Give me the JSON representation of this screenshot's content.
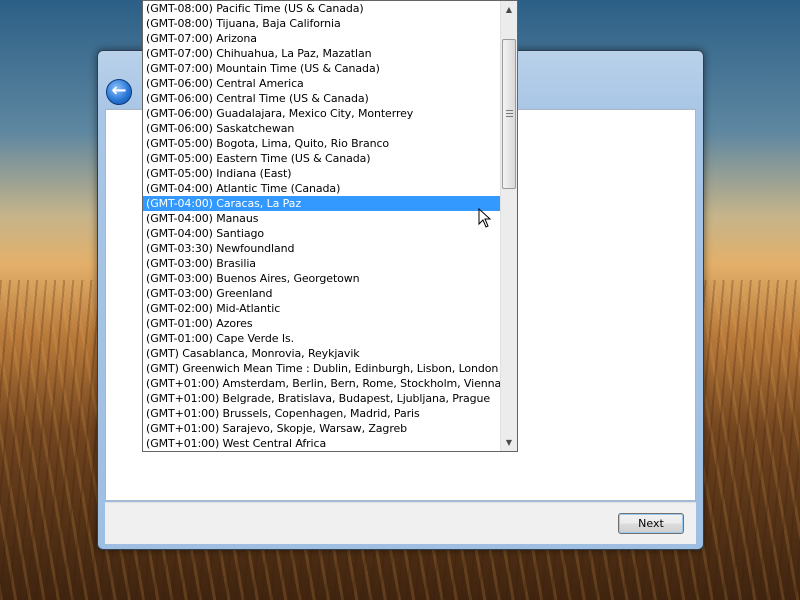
{
  "dialog": {
    "next_label": "Next"
  },
  "icons": {
    "back": "back-arrow-icon",
    "scroll_up": "scroll-up-arrow-icon",
    "scroll_down": "scroll-down-arrow-icon",
    "cursor": "mouse-pointer-icon"
  },
  "colors": {
    "selection": "#3399ff",
    "window_frame": "#a9c6e6"
  },
  "timezones": {
    "selected_index": 13,
    "items": [
      "(GMT-08:00) Pacific Time (US & Canada)",
      "(GMT-08:00) Tijuana, Baja California",
      "(GMT-07:00) Arizona",
      "(GMT-07:00) Chihuahua, La Paz, Mazatlan",
      "(GMT-07:00) Mountain Time (US & Canada)",
      "(GMT-06:00) Central America",
      "(GMT-06:00) Central Time (US & Canada)",
      "(GMT-06:00) Guadalajara, Mexico City, Monterrey",
      "(GMT-06:00) Saskatchewan",
      "(GMT-05:00) Bogota, Lima, Quito, Rio Branco",
      "(GMT-05:00) Eastern Time (US & Canada)",
      "(GMT-05:00) Indiana (East)",
      "(GMT-04:00) Atlantic Time (Canada)",
      "(GMT-04:00) Caracas, La Paz",
      "(GMT-04:00) Manaus",
      "(GMT-04:00) Santiago",
      "(GMT-03:30) Newfoundland",
      "(GMT-03:00) Brasilia",
      "(GMT-03:00) Buenos Aires, Georgetown",
      "(GMT-03:00) Greenland",
      "(GMT-02:00) Mid-Atlantic",
      "(GMT-01:00) Azores",
      "(GMT-01:00) Cape Verde Is.",
      "(GMT) Casablanca, Monrovia, Reykjavik",
      "(GMT) Greenwich Mean Time : Dublin, Edinburgh, Lisbon, London",
      "(GMT+01:00) Amsterdam, Berlin, Bern, Rome, Stockholm, Vienna",
      "(GMT+01:00) Belgrade, Bratislava, Budapest, Ljubljana, Prague",
      "(GMT+01:00) Brussels, Copenhagen, Madrid, Paris",
      "(GMT+01:00) Sarajevo, Skopje, Warsaw, Zagreb",
      "(GMT+01:00) West Central Africa"
    ]
  }
}
